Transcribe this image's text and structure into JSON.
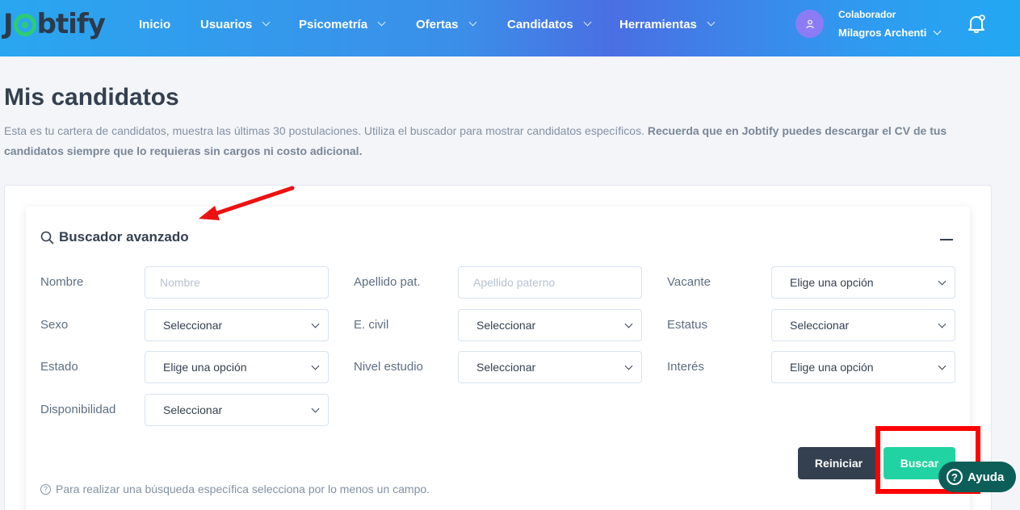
{
  "navbar": {
    "logo": {
      "pre": "J",
      "post": "btify"
    },
    "items": [
      {
        "label": "Inicio",
        "dropdown": false
      },
      {
        "label": "Usuarios",
        "dropdown": true
      },
      {
        "label": "Psicometría",
        "dropdown": true
      },
      {
        "label": "Ofertas",
        "dropdown": true
      },
      {
        "label": "Candidatos",
        "dropdown": true
      },
      {
        "label": "Herramientas",
        "dropdown": true
      }
    ],
    "user": {
      "role": "Colaborador",
      "name": "Milagros Archenti"
    }
  },
  "page": {
    "title": "Mis candidatos",
    "description": "Esta es tu cartera de candidatos, muestra las últimas 30 postulaciones. Utiliza el buscador para mostrar candidatos específicos. ",
    "description_bold": "Recuerda que en Jobtify puedes descargar el CV de tus candidatos siempre que lo requieras sin cargos ni costo adicional."
  },
  "search": {
    "title": "Buscador avanzado",
    "fields": {
      "nombre": {
        "label": "Nombre",
        "placeholder": "Nombre"
      },
      "apellido": {
        "label": "Apellido pat.",
        "placeholder": "Apellido paterno"
      },
      "vacante": {
        "label": "Vacante",
        "value": "Elige una opción"
      },
      "sexo": {
        "label": "Sexo",
        "value": "Seleccionar"
      },
      "ecivil": {
        "label": "E. civil",
        "value": "Seleccionar"
      },
      "estatus": {
        "label": "Estatus",
        "value": "Seleccionar"
      },
      "estado": {
        "label": "Estado",
        "value": "Elige una opción"
      },
      "nivel": {
        "label": "Nivel estudio",
        "value": "Seleccionar"
      },
      "interes": {
        "label": "Interés",
        "value": "Elige una opción"
      },
      "disponibilidad": {
        "label": "Disponibilidad",
        "value": "Seleccionar"
      }
    },
    "reset_label": "Reiniciar",
    "search_label": "Buscar",
    "note": "Para realizar una búsqueda específica selecciona por lo menos un campo."
  },
  "help": {
    "label": "Ayuda",
    "icon": "?"
  },
  "colors": {
    "accent": "#21d3a2",
    "dark": "#344050",
    "annotation": "#ff0000",
    "help": "#0d5e58"
  }
}
